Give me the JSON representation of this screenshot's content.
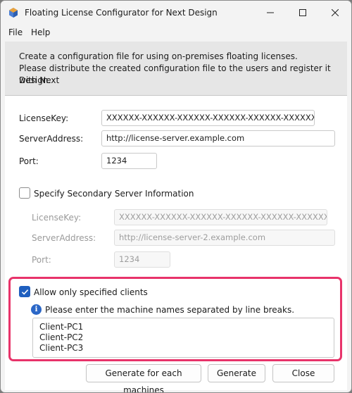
{
  "window": {
    "title": "Floating License Configurator for Next Design"
  },
  "menu": {
    "file": "File",
    "help": "Help"
  },
  "description": {
    "line1": "Create a configuration file for using on-premises floating licenses.",
    "line2": "Please distribute the created configuration file to the users and register it with Next",
    "line3": "Design."
  },
  "primary": {
    "license_key_label": "LicenseKey:",
    "license_key_value": "XXXXXX-XXXXXX-XXXXXX-XXXXXX-XXXXXX-XXXXXX",
    "server_address_label": "ServerAddress:",
    "server_address_value": "http://license-server.example.com",
    "port_label": "Port:",
    "port_value": "1234"
  },
  "secondary": {
    "checkbox_label": "Specify Secondary Server Information",
    "checked": false,
    "license_key_label": "LicenseKey:",
    "license_key_value": "XXXXXX-XXXXXX-XXXXXX-XXXXXX-XXXXXX-XXXXXX",
    "server_address_label": "ServerAddress:",
    "server_address_value": "http://license-server-2.example.com",
    "port_label": "Port:",
    "port_value": "1234"
  },
  "clients": {
    "checkbox_label": "Allow only specified clients",
    "checked": true,
    "info_text": "Please enter the machine names separated by line breaks.",
    "machines": [
      "Client-PC1",
      "Client-PC2",
      "Client-PC3"
    ]
  },
  "buttons": {
    "generate_each": "Generate for each machines",
    "generate": "Generate",
    "close": "Close"
  },
  "colors": {
    "highlight": "#e8336a",
    "accent": "#1f5fbf"
  }
}
